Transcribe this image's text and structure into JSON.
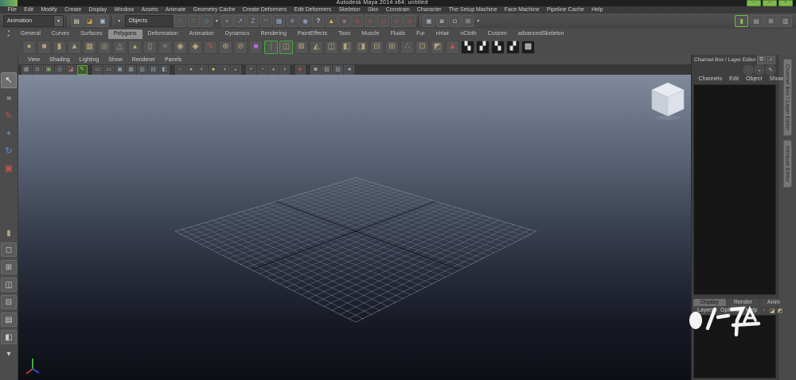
{
  "window": {
    "title": "Autodesk Maya 2014 x64: untitled",
    "controls": [
      {
        "name": "minimize-button",
        "glyph": "–"
      },
      {
        "name": "maximize-button",
        "glyph": "□"
      },
      {
        "name": "close-button",
        "glyph": "×"
      }
    ]
  },
  "menu_bar": {
    "items": [
      {
        "name": "menu-file",
        "label": "File"
      },
      {
        "name": "menu-edit",
        "label": "Edit"
      },
      {
        "name": "menu-modify",
        "label": "Modify"
      },
      {
        "name": "menu-create",
        "label": "Create"
      },
      {
        "name": "menu-display",
        "label": "Display"
      },
      {
        "name": "menu-window",
        "label": "Window"
      },
      {
        "name": "menu-assets",
        "label": "Assets"
      },
      {
        "name": "menu-animate",
        "label": "Animate"
      },
      {
        "name": "menu-geometry-cache",
        "label": "Geometry Cache"
      },
      {
        "name": "menu-create-deformers",
        "label": "Create Deformers"
      },
      {
        "name": "menu-edit-deformers",
        "label": "Edit Deformers"
      },
      {
        "name": "menu-skeleton",
        "label": "Skeleton"
      },
      {
        "name": "menu-skin",
        "label": "Skin"
      },
      {
        "name": "menu-constrain",
        "label": "Constrain"
      },
      {
        "name": "menu-character",
        "label": "Character"
      },
      {
        "name": "menu-the-setup-machine",
        "label": "The Setup Machine"
      },
      {
        "name": "menu-face-machine",
        "label": "Face Machine"
      },
      {
        "name": "menu-pipeline-cache",
        "label": "Pipeline Cache"
      },
      {
        "name": "menu-help",
        "label": "Help"
      }
    ]
  },
  "status_line": {
    "menuset_value": "Animation",
    "selection_mask_value": "Objects",
    "items_left": [
      {
        "name": "status-separator",
        "cls": "sep",
        "interactable": false
      },
      {
        "name": "new-scene-icon",
        "glyph": "▤",
        "color": "#d8d2b2"
      },
      {
        "name": "open-scene-icon",
        "glyph": "◪",
        "color": "#c9a23f"
      },
      {
        "name": "save-scene-icon",
        "glyph": "▣",
        "color": "#a8bacb"
      },
      {
        "name": "status-separator",
        "cls": "sep",
        "interactable": false
      },
      {
        "name": "selection-mode-caret",
        "glyph": "▾",
        "cls": "caret"
      }
    ],
    "items_right": [
      {
        "name": "select-by-hierarchy-icon",
        "glyph": "∴",
        "color": "#3db7aa"
      },
      {
        "name": "select-by-object-type-icon",
        "glyph": "∵",
        "color": "#79b34a"
      },
      {
        "name": "select-by-component-type-icon",
        "glyph": "◇",
        "color": "#4aa3c9"
      },
      {
        "name": "mask-options-caret",
        "glyph": "▾",
        "cls": "caret"
      },
      {
        "name": "mask-points-icon",
        "glyph": "+",
        "color": "#8ca0c4"
      },
      {
        "name": "mask-handles-icon",
        "glyph": "↗",
        "color": "#8ca0c4"
      },
      {
        "name": "mask-curves-icon",
        "glyph": "Z",
        "color": "#8ca0c4"
      },
      {
        "name": "mask-surfaces-icon",
        "glyph": "◠",
        "color": "#8ca0c4"
      },
      {
        "name": "mask-deformations-icon",
        "glyph": "▦",
        "color": "#8ca0c4"
      },
      {
        "name": "mask-dynamics-icon",
        "glyph": "✳",
        "color": "#8ca0c4"
      },
      {
        "name": "mask-rendering-icon",
        "glyph": "◉",
        "color": "#8ca0c4"
      },
      {
        "name": "mask-misc-icon",
        "glyph": "?",
        "color": "#e6e6e6"
      },
      {
        "name": "lock-selection-icon",
        "glyph": "▲",
        "color": "#ddb93f"
      },
      {
        "name": "highlight-selection-icon",
        "glyph": "◆",
        "color": "#8d6f6f"
      },
      {
        "name": "snap-to-grids-icon",
        "glyph": "∪",
        "color": "#c4524b"
      },
      {
        "name": "snap-to-curves-icon",
        "glyph": "∪",
        "color": "#c4524b"
      },
      {
        "name": "snap-to-points-icon",
        "glyph": "∪",
        "color": "#c4524b"
      },
      {
        "name": "snap-to-projected-center-icon",
        "glyph": "∪",
        "color": "#c4524b"
      },
      {
        "name": "snap-to-view-planes-icon",
        "glyph": "∪",
        "color": "#c4524b"
      },
      {
        "name": "status-separator",
        "cls": "sep",
        "interactable": false
      },
      {
        "name": "construction-history-icon",
        "glyph": "▣",
        "color": "#9fa9b5"
      },
      {
        "name": "render-current-frame-icon",
        "glyph": "◙",
        "color": "#9fa9b5"
      },
      {
        "name": "ipr-render-icon",
        "glyph": "◘",
        "color": "#9fa9b5"
      },
      {
        "name": "render-settings-icon",
        "glyph": "⊞",
        "color": "#9fa9b5"
      },
      {
        "name": "status-right-caret",
        "glyph": "▾",
        "cls": "caret"
      }
    ],
    "right_buttons": [
      {
        "name": "toggle-grease-pencil-button",
        "glyph": "▮",
        "color": "#8cc152",
        "cls": "green-frame"
      },
      {
        "name": "show-attribute-editor-button",
        "glyph": "▤",
        "color": "#a9a9a9"
      },
      {
        "name": "show-tool-settings-button",
        "glyph": "⊞",
        "color": "#a9a9a9"
      },
      {
        "name": "show-channel-box-button",
        "glyph": "▥",
        "color": "#a9a9a9"
      }
    ]
  },
  "shelf": {
    "menu_buttons": [
      {
        "name": "shelf-menu-button",
        "glyph": "▾"
      },
      {
        "name": "shelf-editor-button",
        "glyph": "▸"
      }
    ],
    "tabs": [
      {
        "name": "shelf-tab-general",
        "label": "General"
      },
      {
        "name": "shelf-tab-curves",
        "label": "Curves"
      },
      {
        "name": "shelf-tab-surfaces",
        "label": "Surfaces"
      },
      {
        "name": "shelf-tab-polygons",
        "label": "Polygons",
        "active": true
      },
      {
        "name": "shelf-tab-deformation",
        "label": "Deformation"
      },
      {
        "name": "shelf-tab-animation",
        "label": "Animation"
      },
      {
        "name": "shelf-tab-dynamics",
        "label": "Dynamics"
      },
      {
        "name": "shelf-tab-rendering",
        "label": "Rendering"
      },
      {
        "name": "shelf-tab-painteffects",
        "label": "PaintEffects"
      },
      {
        "name": "shelf-tab-toon",
        "label": "Toon"
      },
      {
        "name": "shelf-tab-muscle",
        "label": "Muscle"
      },
      {
        "name": "shelf-tab-fluids",
        "label": "Fluids"
      },
      {
        "name": "shelf-tab-fur",
        "label": "Fur"
      },
      {
        "name": "shelf-tab-nhair",
        "label": "nHair"
      },
      {
        "name": "shelf-tab-ncloth",
        "label": "nCloth"
      },
      {
        "name": "shelf-tab-custom",
        "label": "Custom"
      },
      {
        "name": "shelf-tab-advancedskeleton",
        "label": "advancedSkeleton"
      }
    ],
    "icons": [
      {
        "name": "poly-sphere-icon",
        "glyph": "●",
        "color": "#b3a379"
      },
      {
        "name": "poly-cube-icon",
        "glyph": "■",
        "color": "#b3a379"
      },
      {
        "name": "poly-cylinder-icon",
        "glyph": "▮",
        "color": "#b3a379"
      },
      {
        "name": "poly-cone-icon",
        "glyph": "▲",
        "color": "#b3a379"
      },
      {
        "name": "poly-plane-icon",
        "glyph": "▦",
        "color": "#b3a379"
      },
      {
        "name": "poly-torus-icon",
        "glyph": "◎",
        "color": "#b3a379"
      },
      {
        "name": "poly-prism-icon",
        "glyph": "△",
        "color": "#b3a379"
      },
      {
        "name": "poly-pyramid-icon",
        "glyph": "▴",
        "color": "#b3a379"
      },
      {
        "name": "poly-pipe-icon",
        "glyph": "▯",
        "color": "#b3a379"
      },
      {
        "name": "poly-helix-icon",
        "glyph": "≈",
        "color": "#b3a379"
      },
      {
        "name": "poly-soccer-ball-icon",
        "glyph": "◉",
        "color": "#b3a379"
      },
      {
        "name": "poly-platonic-solid-icon",
        "glyph": "◆",
        "color": "#b3a379"
      },
      {
        "name": "sculpt-geometry-icon",
        "glyph": "✎",
        "color": "#c4524b"
      },
      {
        "name": "combine-icon",
        "glyph": "⊕",
        "color": "#b3a379"
      },
      {
        "name": "separate-icon",
        "glyph": "⊘",
        "color": "#b3a379"
      },
      {
        "name": "smooth-icon",
        "glyph": "■",
        "color": "#b06fd4"
      },
      {
        "name": "mirror-cut-icon",
        "glyph": "❘",
        "color": "#3fae3f",
        "cls": "green-frame"
      },
      {
        "name": "mirror-geometry-icon",
        "glyph": "◫",
        "color": "#b3a379",
        "cls": "green-frame"
      },
      {
        "name": "extrude-icon",
        "glyph": "⊠",
        "color": "#b3a379"
      },
      {
        "name": "bevel-icon",
        "glyph": "◭",
        "color": "#b3a379"
      },
      {
        "name": "bridge-icon",
        "glyph": "◫",
        "color": "#b3a379"
      },
      {
        "name": "append-polygon-icon",
        "glyph": "◧",
        "color": "#b3a379"
      },
      {
        "name": "split-polygon-icon",
        "glyph": "◨",
        "color": "#b3a379"
      },
      {
        "name": "insert-edge-loop-icon",
        "glyph": "⊟",
        "color": "#b3a379"
      },
      {
        "name": "offset-edge-loop-icon",
        "glyph": "⊞",
        "color": "#b3a379"
      },
      {
        "name": "merge-vertices-icon",
        "glyph": "∴",
        "color": "#b3a379"
      },
      {
        "name": "delete-edge-icon",
        "glyph": "⊡",
        "color": "#b3a379"
      },
      {
        "name": "quad-draw-icon",
        "glyph": "◩",
        "color": "#b3a379"
      },
      {
        "name": "poly-reduce-icon",
        "glyph": "▲",
        "color": "#c4524b"
      },
      {
        "name": "uv-planar-mapping-icon",
        "glyph": "▚",
        "cls": "checker"
      },
      {
        "name": "uv-cylindrical-mapping-icon",
        "glyph": "▞",
        "cls": "checker"
      },
      {
        "name": "uv-spherical-mapping-icon",
        "glyph": "▚",
        "cls": "checker"
      },
      {
        "name": "uv-automatic-mapping-icon",
        "glyph": "▞",
        "cls": "checker"
      },
      {
        "name": "uv-texture-editor-icon",
        "glyph": "▩",
        "cls": "checker"
      }
    ]
  },
  "toolbox": {
    "tools": [
      {
        "name": "select-tool",
        "glyph": "↖",
        "color": "#f0f0f0",
        "active": true
      },
      {
        "name": "lasso-select-tool",
        "glyph": "≈",
        "color": "#d8d8d8"
      },
      {
        "name": "paint-selection-tool",
        "glyph": "✎",
        "color": "#c4524b"
      },
      {
        "name": "move-tool",
        "glyph": "+",
        "color": "#6fb3d8"
      },
      {
        "name": "rotate-tool",
        "glyph": "↻",
        "color": "#5b8fd4"
      },
      {
        "name": "scale-tool",
        "glyph": "▣",
        "color": "#c4524b"
      }
    ],
    "layouts": [
      {
        "name": "last-tool-used-slot",
        "glyph": "▮",
        "color": "#b3a379",
        "cls": "plain"
      },
      {
        "name": "layout-single-perspective-button",
        "glyph": "◻"
      },
      {
        "name": "layout-four-view-button",
        "glyph": "⊞"
      },
      {
        "name": "layout-persp-outliner-button",
        "glyph": "◫"
      },
      {
        "name": "layout-persp-graph-button",
        "glyph": "⊟"
      },
      {
        "name": "layout-hypershade-persp-button",
        "glyph": "▤"
      },
      {
        "name": "layout-persp-uv-button",
        "glyph": "◧"
      },
      {
        "name": "layout-menu-caret",
        "glyph": "▾",
        "cls": "plain"
      }
    ]
  },
  "viewport": {
    "menus": [
      {
        "name": "panel-menu-view",
        "label": "View"
      },
      {
        "name": "panel-menu-shading",
        "label": "Shading"
      },
      {
        "name": "panel-menu-lighting",
        "label": "Lighting"
      },
      {
        "name": "panel-menu-show",
        "label": "Show"
      },
      {
        "name": "panel-menu-renderer",
        "label": "Renderer"
      },
      {
        "name": "panel-menu-panels",
        "label": "Panels"
      }
    ],
    "toolbar": [
      {
        "name": "select-camera-icon",
        "glyph": "▦"
      },
      {
        "name": "lock-camera-icon",
        "glyph": "◘"
      },
      {
        "name": "camera-attributes-icon",
        "glyph": "▣",
        "color": "#7fae6a"
      },
      {
        "name": "bookmarks-icon",
        "glyph": "◎"
      },
      {
        "name": "image-plane-icon",
        "glyph": "◪",
        "color": "#b3756f"
      },
      {
        "name": "grease-pencil-icon",
        "glyph": "✎",
        "color": "#9fd65f",
        "cls": "green-frame"
      },
      {
        "name": "film-gate-icon",
        "glyph": "▭",
        "cls": "gap",
        "color": "#9fb3c8"
      },
      {
        "name": "resolution-gate-icon",
        "glyph": "▭",
        "color": "#9fb3c8"
      },
      {
        "name": "gate-mask-icon",
        "glyph": "▣",
        "color": "#8fa3b8"
      },
      {
        "name": "field-chart-icon",
        "glyph": "▦",
        "color": "#8fa3b8"
      },
      {
        "name": "safe-action-icon",
        "glyph": "▥",
        "color": "#8fa3b8"
      },
      {
        "name": "safe-title-icon",
        "glyph": "▤",
        "color": "#8fa3b8"
      },
      {
        "name": "fill-mode-icon",
        "glyph": "◧",
        "color": "#8fa3b8"
      },
      {
        "name": "wireframe-mode-icon",
        "glyph": "○",
        "cls": "gap"
      },
      {
        "name": "shaded-mode-icon",
        "glyph": "●"
      },
      {
        "name": "textured-mode-icon",
        "glyph": "◐"
      },
      {
        "name": "use-all-lights-icon",
        "glyph": "●",
        "color": "#e3cf4e"
      },
      {
        "name": "shadows-icon",
        "glyph": "◑"
      },
      {
        "name": "screen-space-ao-icon",
        "glyph": "◒"
      },
      {
        "name": "isolate-select-icon",
        "glyph": "◓",
        "cls": "gap"
      },
      {
        "name": "xray-icon",
        "glyph": "◔"
      },
      {
        "name": "xray-active-components-icon",
        "glyph": "◕"
      },
      {
        "name": "xray-joints-icon",
        "glyph": "◖"
      },
      {
        "name": "exposure-icon",
        "glyph": "◈",
        "cls": "gap",
        "color": "#c05050"
      },
      {
        "name": "scene-render-view-icon",
        "glyph": "◙",
        "cls": "gap",
        "color": "#9aa7b8"
      },
      {
        "name": "texture-view-icon",
        "glyph": "▧",
        "color": "#9aa7b8"
      },
      {
        "name": "lookdev-view-icon",
        "glyph": "▨",
        "color": "#9aa7b8"
      },
      {
        "name": "share-view-icon",
        "glyph": "◄",
        "color": "#9aa7b8"
      }
    ]
  },
  "channel_box": {
    "title": "Channel Box / Layer Editor",
    "header_buttons": [
      {
        "name": "copy-tab-button",
        "glyph": "⧉"
      },
      {
        "name": "close-panel-button",
        "glyph": "×"
      }
    ],
    "tool_icons": [
      {
        "name": "manipulator-state-icon",
        "glyph": "∷",
        "color": "#cc6655"
      },
      {
        "name": "speed-state-icon",
        "glyph": "◒",
        "color": "#9a9a9a"
      },
      {
        "name": "slider-mode-icon",
        "glyph": "✎",
        "color": "#bbbbbb"
      }
    ],
    "menus": [
      {
        "name": "channel-box-menu-channels",
        "label": "Channels"
      },
      {
        "name": "channel-box-menu-edit",
        "label": "Edit"
      },
      {
        "name": "channel-box-menu-object",
        "label": "Object"
      },
      {
        "name": "channel-box-menu-show",
        "label": "Show"
      }
    ]
  },
  "layer_editor": {
    "tabs": [
      {
        "name": "layer-tab-display",
        "label": "Display",
        "active": true
      },
      {
        "name": "layer-tab-render",
        "label": "Render"
      },
      {
        "name": "layer-tab-anim",
        "label": "Anim"
      }
    ],
    "menus": [
      {
        "name": "layer-menu-layers",
        "label": "Layers"
      },
      {
        "name": "layer-menu-options",
        "label": "Options"
      },
      {
        "name": "layer-menu-help",
        "label": "Help"
      }
    ],
    "icons": [
      {
        "name": "current-layer-indicator-icon",
        "glyph": "▪",
        "color": "#b35a4f"
      },
      {
        "name": "create-empty-layer-icon",
        "glyph": "◪",
        "color": "#c7b98a"
      },
      {
        "name": "create-layer-from-selected-icon",
        "glyph": "◩",
        "color": "#c7b98a"
      }
    ]
  },
  "side_tabs": [
    {
      "name": "side-tab-channel-box-layer-editor",
      "label": "Channel Box / Layer Editor"
    },
    {
      "name": "side-tab-attribute-editor",
      "label": "Attribute Editor"
    }
  ],
  "colors": {
    "accent_green": "#7fb94e",
    "viewport_gradient_top": "#7f8a9b",
    "viewport_gradient_bottom": "#0d0f15",
    "grid_line": "#ced8e6",
    "axis_line": "#0c0f16",
    "shelf_icon_khaki": "#b3a379",
    "active_tab_gray": "#8f8f8f"
  }
}
